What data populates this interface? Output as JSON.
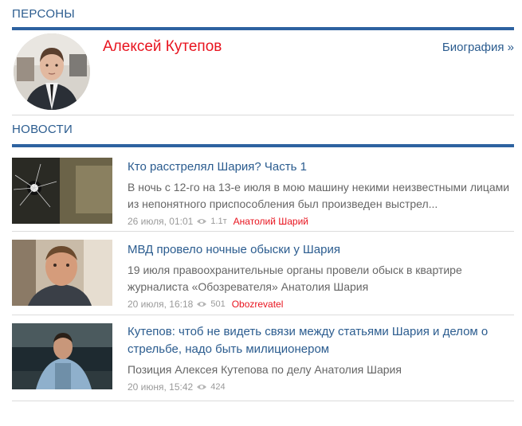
{
  "persons": {
    "title": "ПЕРСОНЫ",
    "name": "Алексей Кутепов",
    "bio_link": "Биография »"
  },
  "news": {
    "title": "НОВОСТИ",
    "items": [
      {
        "title": "Кто расстрелял Шария? Часть 1",
        "desc": "В ночь с 12-го на 13-е июля в мою машину некими неизвестными лицами из непонятного приспособления был произведен выстрел...",
        "date": "26 июля, 01:01",
        "views": "1.1т",
        "source": "Анатолий Шарий"
      },
      {
        "title": "МВД провело ночные обыски у Шария",
        "desc": "19 июля правоохранительные органы провели обыск в квартире журналиста «Обозревателя» Анатолия Шария",
        "date": "20 июля, 16:18",
        "views": "501",
        "source": "Obozrevatel"
      },
      {
        "title": "Кутепов: чтоб не видеть связи между статьями Шария и делом о стрельбе, надо быть милиционером",
        "desc": "Позиция Алексея Кутепова по делу Анатолия Шария",
        "date": "20 июня, 15:42",
        "views": "424",
        "source": ""
      }
    ]
  },
  "colors": {
    "accent": "#2d62a0",
    "link": "#2b5c8f",
    "name_red": "#e8141f"
  }
}
